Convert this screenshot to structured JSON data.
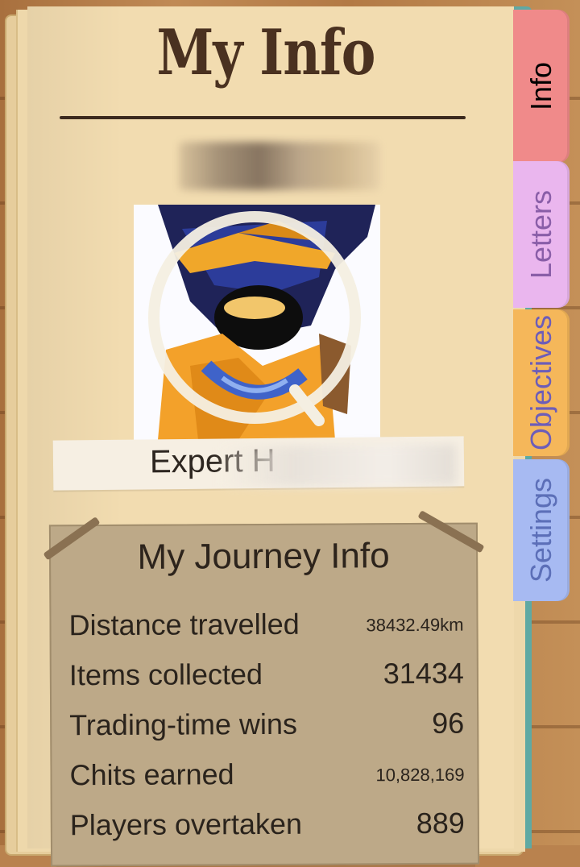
{
  "page": {
    "title": "My Info"
  },
  "profile": {
    "rank_title_visible": "Expert H"
  },
  "journey": {
    "heading": "My Journey Info",
    "stats": [
      {
        "label": "Distance travelled",
        "value": "38432.49km"
      },
      {
        "label": "Items collected",
        "value": "31434"
      },
      {
        "label": "Trading-time wins",
        "value": "96"
      },
      {
        "label": "Chits earned",
        "value": "10,828,169"
      },
      {
        "label": "Players overtaken",
        "value": "889"
      }
    ]
  },
  "tabs": [
    {
      "label": "Info",
      "color": "#f08a8a"
    },
    {
      "label": "Letters",
      "color": "#eab6ee"
    },
    {
      "label": "Objectives",
      "color": "#f5b75a"
    },
    {
      "label": "Settings",
      "color": "#a7baf2"
    }
  ]
}
